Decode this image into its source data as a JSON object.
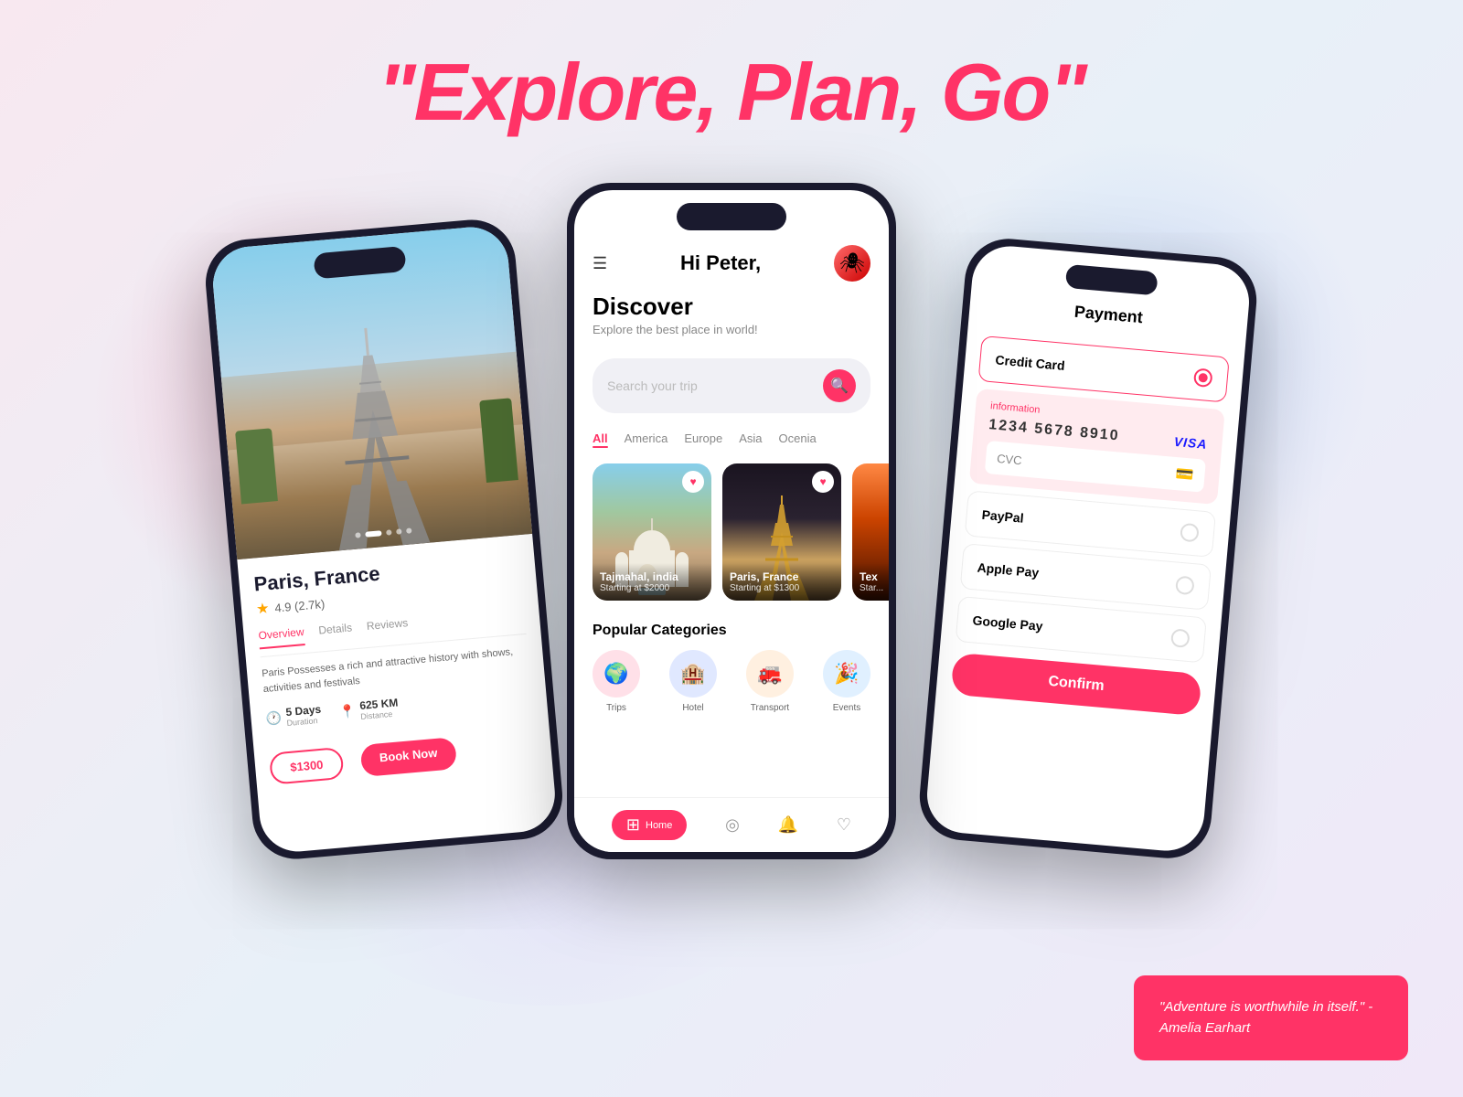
{
  "page": {
    "title": "\"Explore, Plan, Go\"",
    "quote": "\"Adventure is worthwhile in itself.\" - Amelia Earhart"
  },
  "bg_glows": {
    "pink": "rgba(255,100,150,0.25)",
    "blue": "rgba(100,150,255,0.2)",
    "purple": "rgba(200,150,255,0.15)"
  },
  "phone_left": {
    "destination": "Paris, France",
    "rating": "4.9 (2.7k)",
    "tabs": [
      "Overview",
      "Details",
      "Reviews"
    ],
    "active_tab": "Overview",
    "description": "Paris Possesses a rich and attractive history with shows, activities and festivals",
    "meta": {
      "duration_label": "5 Days",
      "duration_sub": "Duration",
      "distance_label": "625 KM",
      "distance_sub": "Distance"
    },
    "price_btn": "$1300",
    "back_arrow": "←"
  },
  "phone_center": {
    "greeting": "Hi Peter,",
    "discover_title": "Discover",
    "discover_sub": "Explore the best place  in world!",
    "search_placeholder": "Search your trip",
    "filter_tabs": [
      "All",
      "America",
      "Europe",
      "Asia",
      "Ocenia"
    ],
    "active_filter": "All",
    "destinations": [
      {
        "name": "Tajmahal, India",
        "price": "Starting at $2000",
        "liked": true
      },
      {
        "name": "Paris, France",
        "price": "Starting at $1300",
        "liked": true
      },
      {
        "name": "Tex",
        "price": "Star...",
        "liked": false
      }
    ],
    "popular_categories": {
      "title": "Popular Categories",
      "items": [
        {
          "label": "Trips",
          "emoji": "🌍"
        },
        {
          "label": "Hotel",
          "emoji": "🏨"
        },
        {
          "label": "Transport",
          "emoji": "🚒"
        },
        {
          "label": "Events",
          "emoji": "🎉"
        }
      ]
    },
    "nav": {
      "items": [
        {
          "label": "Home",
          "icon": "⊞",
          "active": true
        },
        {
          "label": "",
          "icon": "◎",
          "active": false
        },
        {
          "label": "",
          "icon": "🔔",
          "active": false
        },
        {
          "label": "",
          "icon": "♡",
          "active": false
        }
      ]
    }
  },
  "phone_right": {
    "title": "Payment",
    "options": [
      {
        "label": "Credit Card",
        "selected": true
      },
      {
        "label": "PayPal",
        "selected": false
      },
      {
        "label": "Apple Pay",
        "selected": false
      },
      {
        "label": "Google Pay",
        "selected": false
      }
    ],
    "card_info": {
      "label": "information",
      "number": "1234  5678  8910",
      "brand": "VISA",
      "cvc_placeholder": "CVC"
    },
    "confirm_label": "Confirm"
  }
}
